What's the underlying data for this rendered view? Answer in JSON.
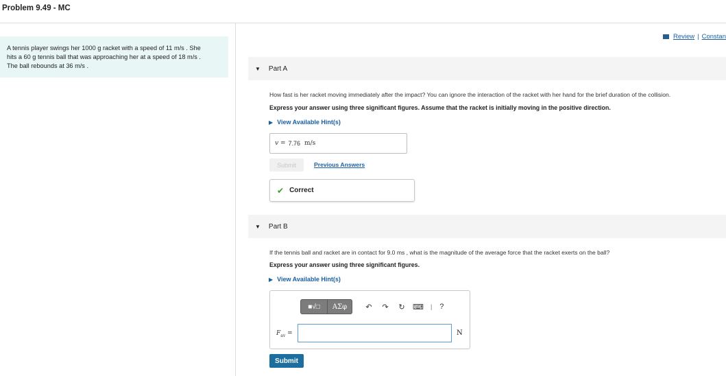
{
  "page": {
    "title": "Problem 9.49 - MC"
  },
  "problem": {
    "line1": "A tennis player swings her 1000 g racket with a speed of 11 m/s . She",
    "line2": "hits a 60 g tennis ball that was approaching her at a speed of 18 m/s .",
    "line3": "The ball rebounds at 36 m/s ."
  },
  "links": {
    "review": "Review",
    "separator": "|",
    "constants": "Constan"
  },
  "partA": {
    "label": "Part A",
    "question": "How fast is her racket moving immediately after the impact? You can ignore the interaction of the racket with her hand for the brief duration of the collision.",
    "instruction": "Express your answer using three significant figures. Assume that the racket is initially moving in the positive direction.",
    "hint": "View Available Hint(s)",
    "answer_label": "v =",
    "answer_value": "7.76",
    "answer_unit": "m/s",
    "submit": "Submit",
    "previous": "Previous Answers",
    "status": "Correct"
  },
  "partB": {
    "label": "Part B",
    "question": "If the tennis ball and racket are in contact for 9.0 ms , what is the magnitude of the average force that the racket exerts on the ball?",
    "instruction": "Express your answer using three significant figures.",
    "hint": "View Available Hint(s)",
    "toolbar": {
      "frac": "■√□",
      "greek": "ΑΣφ",
      "undo": "↶",
      "redo": "↷",
      "reset": "↻",
      "keyboard": "⌨",
      "sep": "|",
      "help": "?"
    },
    "var_symbol": "F",
    "var_sub": "av",
    "var_eq": "=",
    "input_value": "",
    "unit": "N",
    "submit": "Submit"
  }
}
